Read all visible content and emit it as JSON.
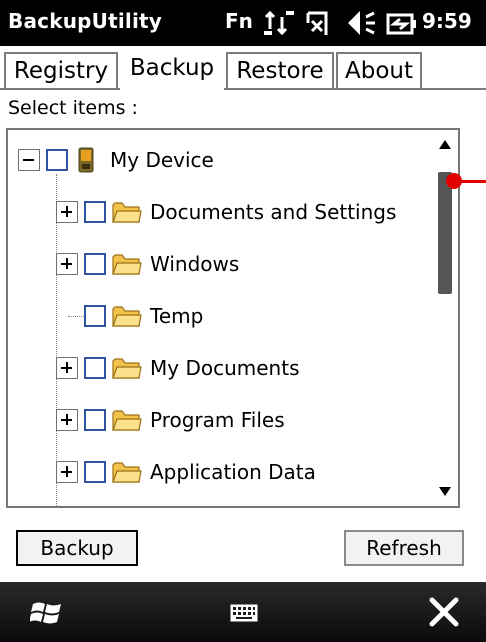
{
  "titlebar": {
    "app_title": "BackupUtility",
    "fn_label": "Fn",
    "clock": "9:59",
    "icons": [
      "connectivity-icon",
      "signal-icon",
      "volume-icon",
      "battery-icon"
    ]
  },
  "tabs": [
    {
      "label": "Registry",
      "active": false
    },
    {
      "label": "Backup",
      "active": true
    },
    {
      "label": "Restore",
      "active": false
    },
    {
      "label": "About",
      "active": false
    }
  ],
  "select_label": "Select items :",
  "tree": {
    "root": {
      "label": "My Device",
      "expanded": true,
      "checked": false
    },
    "children": [
      {
        "label": "Documents and Settings",
        "expandable": true,
        "checked": false
      },
      {
        "label": "Windows",
        "expandable": true,
        "checked": false
      },
      {
        "label": "Temp",
        "expandable": false,
        "checked": false
      },
      {
        "label": "My Documents",
        "expandable": true,
        "checked": false
      },
      {
        "label": "Program Files",
        "expandable": true,
        "checked": false
      },
      {
        "label": "Application Data",
        "expandable": true,
        "checked": false
      }
    ]
  },
  "buttons": {
    "backup": "Backup",
    "refresh": "Refresh"
  },
  "colors": {
    "titlebar_bg": "#000000",
    "checkbox_border": "#2f55a0",
    "folder_fill": "#f3c24a",
    "annotation": "#e00000"
  },
  "bottombar": {
    "icons": [
      "windows-start-icon",
      "keyboard-icon",
      "close-icon"
    ]
  }
}
